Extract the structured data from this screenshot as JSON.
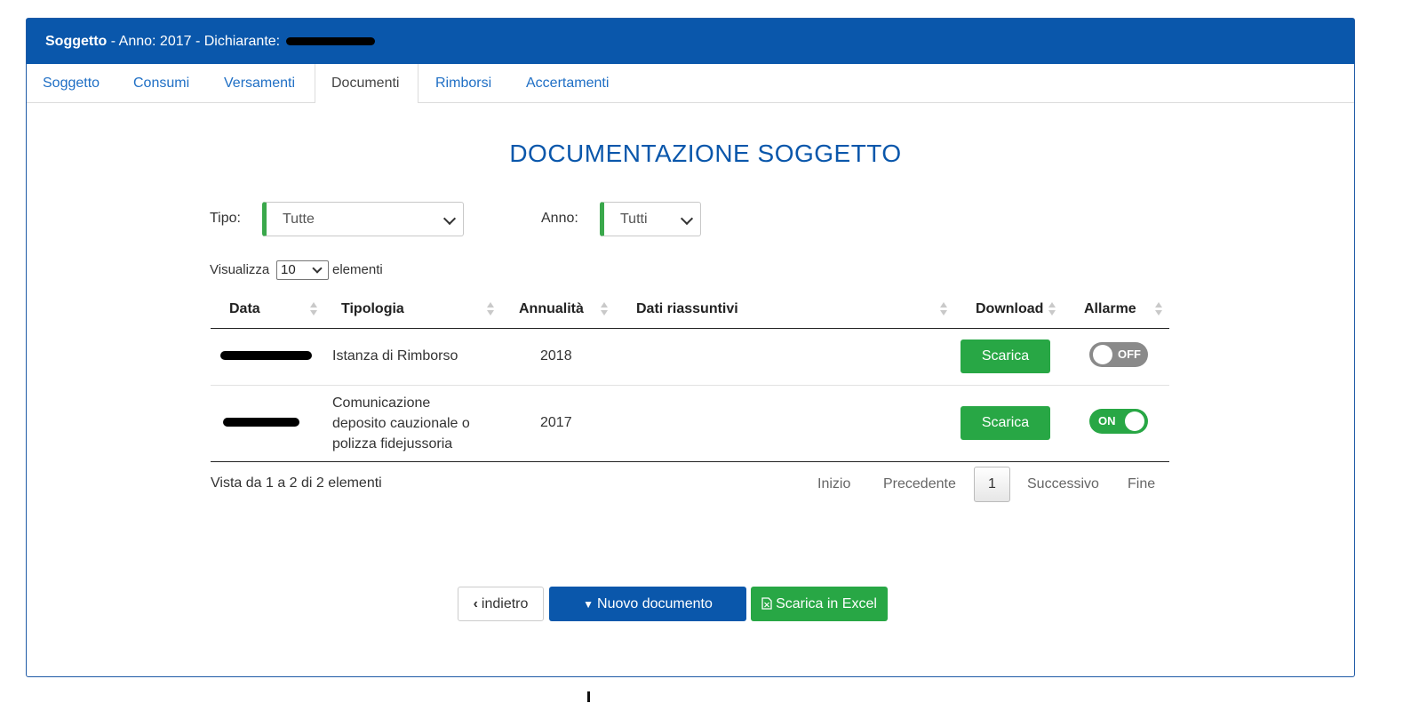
{
  "header": {
    "subject_label": "Soggetto",
    "rest": " - Anno: 2017 - Dichiarante: "
  },
  "tabs": [
    {
      "label": "Soggetto"
    },
    {
      "label": "Consumi"
    },
    {
      "label": "Versamenti"
    },
    {
      "label": "Documenti",
      "active": true
    },
    {
      "label": "Rimborsi"
    },
    {
      "label": "Accertamenti"
    }
  ],
  "title": "DOCUMENTAZIONE SOGGETTO",
  "filters": {
    "tipo_label": "Tipo:",
    "tipo_value": "Tutte",
    "anno_label": "Anno:",
    "anno_value": "Tutti"
  },
  "length": {
    "prefix": "Visualizza",
    "value": "10",
    "suffix": "elementi"
  },
  "table": {
    "columns": [
      "Data",
      "Tipologia",
      "Annualità",
      "Dati riassuntivi",
      "Download",
      "Allarme"
    ],
    "rows": [
      {
        "tipologia": "Istanza di Rimborso",
        "annualita": "2018",
        "download": "Scarica",
        "allarme": "OFF"
      },
      {
        "tipologia": "Comunicazione deposito cauzionale o polizza fidejussoria",
        "annualita": "2017",
        "download": "Scarica",
        "allarme": "ON"
      }
    ]
  },
  "info": "Vista da 1 a 2 di 2 elementi",
  "pagination": {
    "first": "Inizio",
    "prev": "Precedente",
    "current": "1",
    "next": "Successivo",
    "last": "Fine"
  },
  "actions": {
    "back": "indietro",
    "new_doc": "Nuovo documento",
    "excel": "Scarica in Excel"
  },
  "colors": {
    "primary": "#0a57ab",
    "success": "#28a745",
    "toggle_off": "#8a8a8a"
  }
}
